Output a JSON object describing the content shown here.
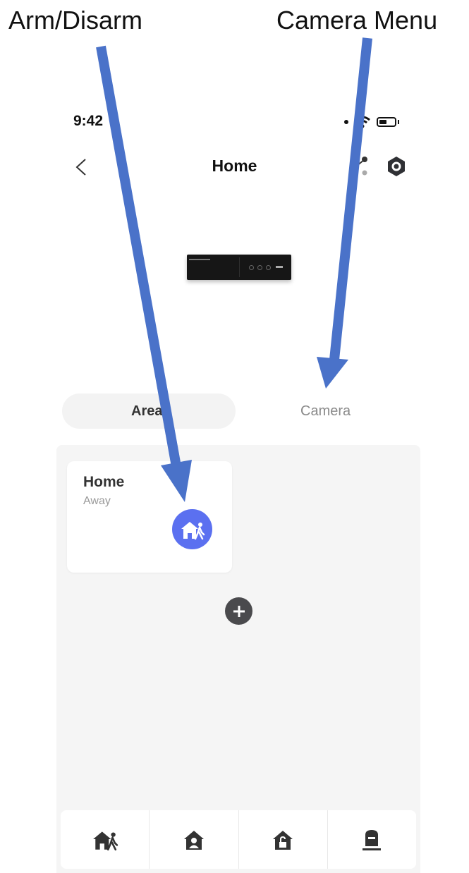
{
  "annotations": {
    "left": "Arm/Disarm",
    "right": "Camera Menu"
  },
  "status_bar": {
    "time": "9:42"
  },
  "header": {
    "title": "Home"
  },
  "tabs": [
    {
      "label": "Area",
      "selected": true
    },
    {
      "label": "Camera",
      "selected": false
    }
  ],
  "area_card": {
    "name": "Home",
    "status": "Away",
    "status_icon": "away-arm-icon"
  },
  "bottom_bar": {
    "modes": [
      "away-arm-icon",
      "stay-arm-icon",
      "disarm-icon",
      "alarm-clear-icon"
    ]
  },
  "colors": {
    "accent": "#5b70f0",
    "annotation_arrow": "#4a72c9",
    "panel_bg": "#f5f5f5"
  }
}
